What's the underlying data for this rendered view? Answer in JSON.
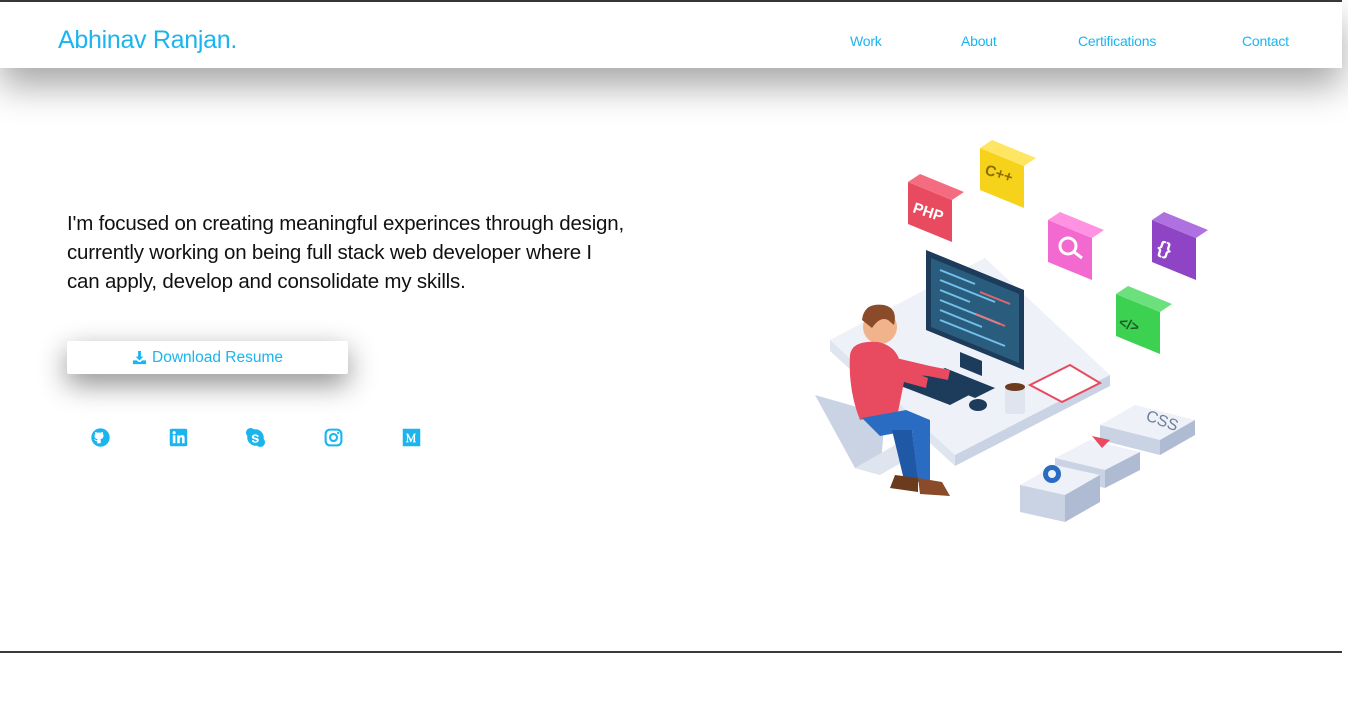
{
  "brand": {
    "name": "Abhinav Ranjan."
  },
  "nav": {
    "items": [
      {
        "label": "Work"
      },
      {
        "label": "About"
      },
      {
        "label": "Certifications"
      },
      {
        "label": "Contact"
      }
    ]
  },
  "hero": {
    "intro": "I'm focused on creating meaningful experinces through design, currently working on being full stack web developer where I can apply, develop and consolidate my skills.",
    "download_label": "Download Resume"
  },
  "social": {
    "icons": [
      "github-icon",
      "linkedin-icon",
      "skype-icon",
      "instagram-icon",
      "medium-icon"
    ]
  },
  "illustration": {
    "badges": [
      {
        "label": "PHP",
        "color": "#e84a5f"
      },
      {
        "label": "C++",
        "color": "#f7d21b"
      },
      {
        "label": "{}",
        "color": "#8e44c4"
      },
      {
        "label": "</>",
        "color": "#3dd152"
      },
      {
        "label": "CSS",
        "color": "#c9d3e4"
      }
    ]
  },
  "colors": {
    "accent": "#1ab5ef",
    "text": "#111111"
  }
}
